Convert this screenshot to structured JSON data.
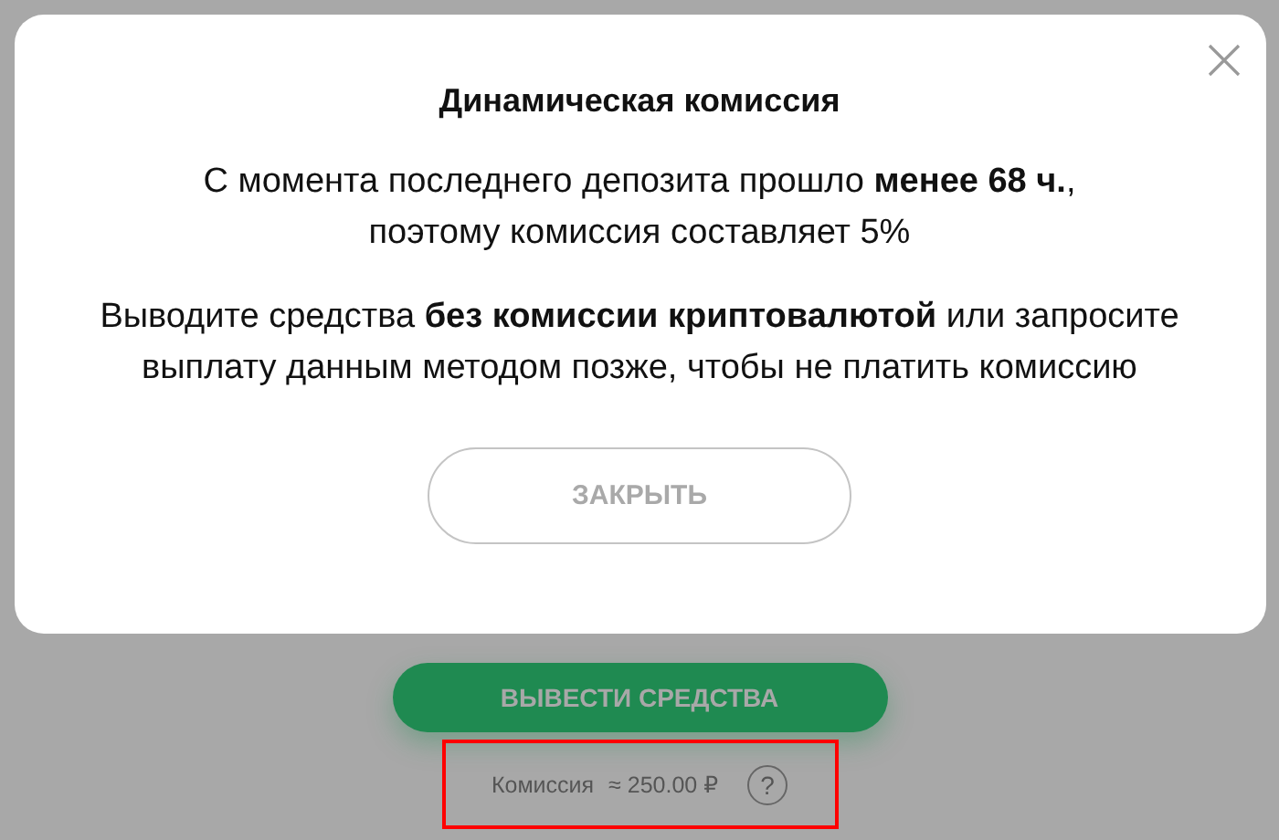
{
  "modal": {
    "title": "Динамическая комиссия",
    "paragraphs": [
      "С момента последнего депозита прошло **менее 68 ч.**, поэтому комиссия составляет  5%",
      "Выводите средства **без комиссии криптовалютой** или запросите выплату данным методом позже, чтобы не платить комиссию"
    ],
    "close_button": "ЗАКРЫТЬ"
  },
  "withdraw_button": "ВЫВЕСТИ СРЕДСТВА",
  "commission": {
    "label": "Комиссия",
    "amount": "≈ 250.00 ₽",
    "help": "?",
    "highlighted": true
  }
}
